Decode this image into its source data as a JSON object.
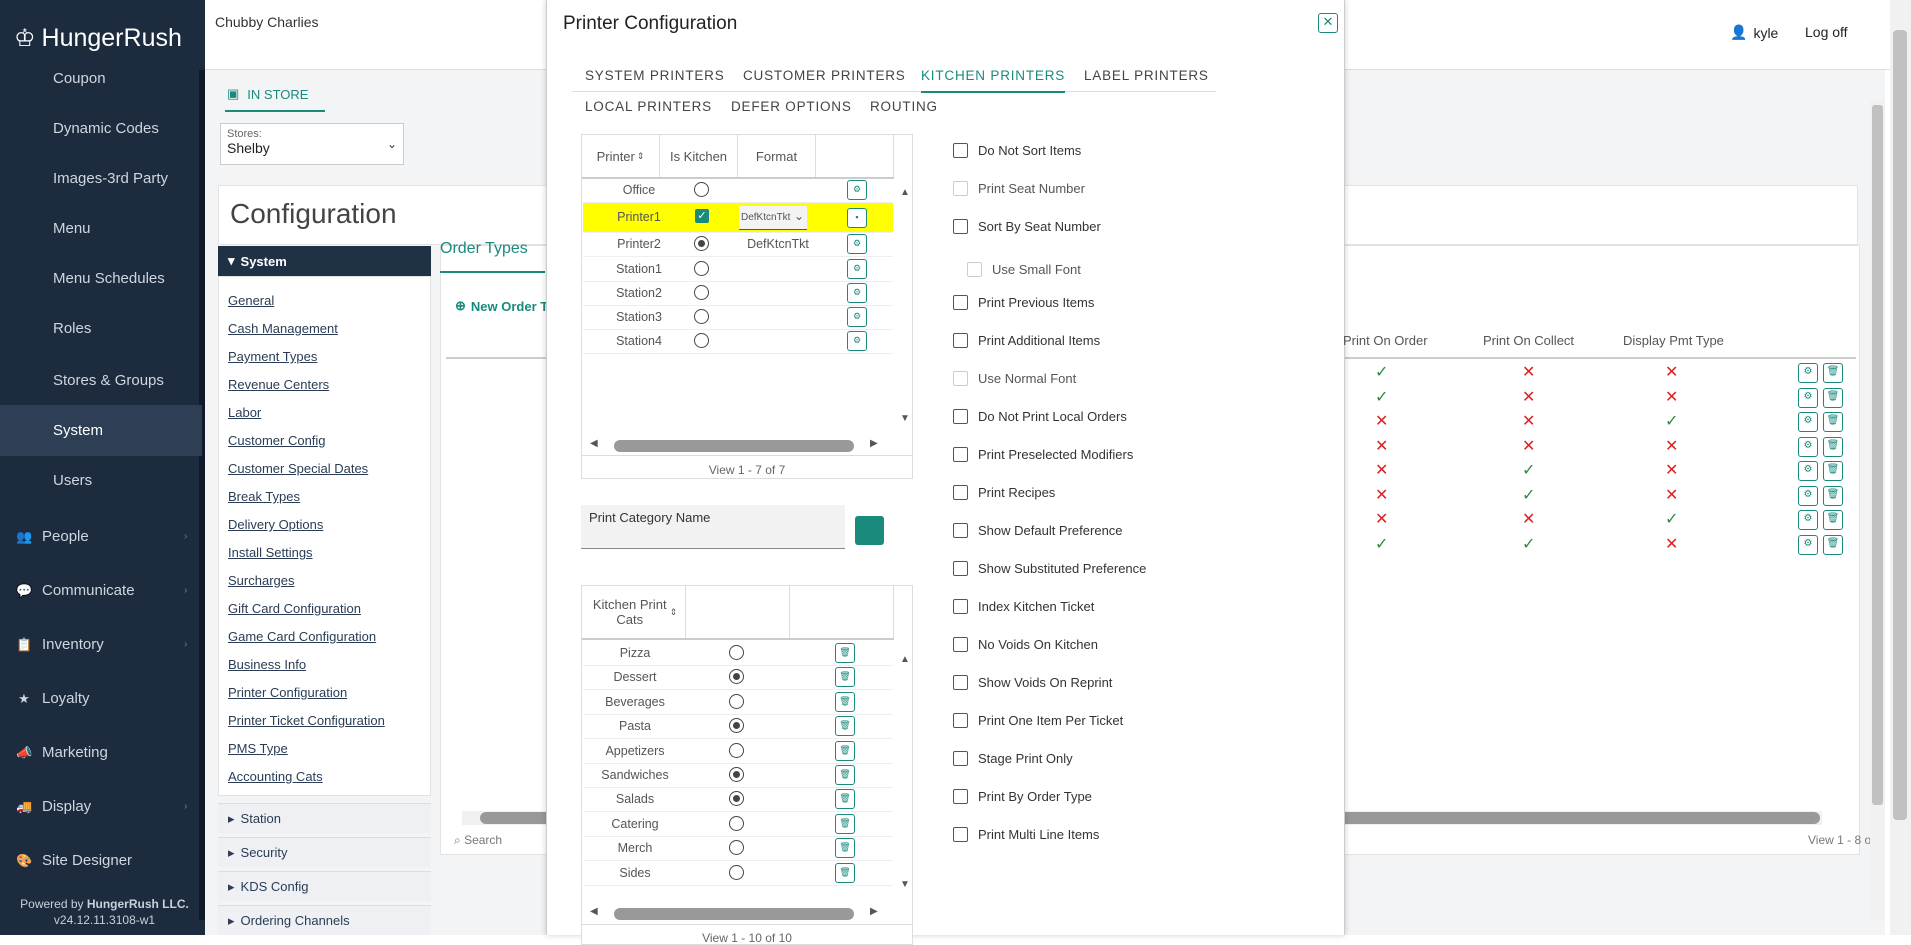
{
  "sidebar": {
    "logo": "HungerRush",
    "sub_items": [
      "Coupon",
      "Dynamic Codes",
      "Images-3rd Party",
      "Menu",
      "Menu Schedules",
      "Roles",
      "Stores & Groups",
      "System",
      "Users"
    ],
    "main_items": [
      {
        "label": "People",
        "icon": "people-icon"
      },
      {
        "label": "Communicate",
        "icon": "chat-icon"
      },
      {
        "label": "Inventory",
        "icon": "clipboard-icon"
      },
      {
        "label": "Loyalty",
        "icon": "star-icon"
      },
      {
        "label": "Marketing",
        "icon": "megaphone-icon"
      },
      {
        "label": "Display",
        "icon": "truck-icon"
      },
      {
        "label": "Site Designer",
        "icon": "palette-icon"
      }
    ],
    "powered_prefix": "Powered by ",
    "powered_brand": "HungerRush LLC.",
    "version": "v24.12.11.3108-w1"
  },
  "topbar": {
    "store_name": "Chubby Charlies",
    "user": "kyle",
    "logoff": "Log off"
  },
  "main": {
    "tab": "IN STORE",
    "stores_label": "Stores:",
    "stores_value": "Shelby",
    "title": "Configuration",
    "system_header": "System",
    "system_links": [
      "General",
      "Cash Management",
      "Payment Types",
      "Revenue Centers",
      "Labor",
      "Customer Config",
      "Customer Special Dates",
      "Break Types",
      "Delivery Options",
      "Install Settings",
      "Surcharges",
      "Gift Card Configuration",
      "Game Card Configuration",
      "Business Info",
      "Printer Configuration",
      "Printer Ticket Configuration",
      "PMS Type",
      "Accounting Cats"
    ],
    "accordions": [
      "Station",
      "Security",
      "KDS Config",
      "Ordering Channels"
    ],
    "order_types_tab": "Order Types",
    "new_order_btn": "New Order T",
    "bg_columns": [
      "Print On Order",
      "Print On Collect",
      "Display Pmt Type"
    ],
    "bg_rows": [
      [
        "check",
        "x",
        "x"
      ],
      [
        "check",
        "x",
        "x"
      ],
      [
        "x",
        "x",
        "check"
      ],
      [
        "x",
        "x",
        "x"
      ],
      [
        "x",
        "check",
        "x"
      ],
      [
        "x",
        "check",
        "x"
      ],
      [
        "x",
        "x",
        "check"
      ],
      [
        "check",
        "check",
        "x"
      ]
    ],
    "search_label": "Search",
    "view_label": "View 1 - 8 o"
  },
  "modal": {
    "title": "Printer Configuration",
    "tabs_row1": [
      "SYSTEM PRINTERS",
      "CUSTOMER PRINTERS",
      "KITCHEN PRINTERS",
      "LABEL PRINTERS"
    ],
    "tabs_row2": [
      "LOCAL PRINTERS",
      "DEFER OPTIONS",
      "ROUTING"
    ],
    "active_tab": "KITCHEN PRINTERS",
    "printers_grid": {
      "headers": [
        "Printer",
        "Is Kitchen",
        "Format",
        ""
      ],
      "rows": [
        {
          "name": "Office",
          "kitchen": "off",
          "format": ""
        },
        {
          "name": "Printer1",
          "kitchen": "checked",
          "format": "DefKtcnTkt",
          "editing": true
        },
        {
          "name": "Printer2",
          "kitchen": "on",
          "format": "DefKtcnTkt"
        },
        {
          "name": "Station1",
          "kitchen": "off",
          "format": ""
        },
        {
          "name": "Station2",
          "kitchen": "off",
          "format": ""
        },
        {
          "name": "Station3",
          "kitchen": "off",
          "format": ""
        },
        {
          "name": "Station4",
          "kitchen": "off",
          "format": ""
        }
      ],
      "footer": "View 1 - 7 of 7",
      "highlight_color": "#ffff00"
    },
    "print_category_label": "Print Category Name",
    "cats_grid": {
      "headers": [
        "Kitchen Print Cats",
        "",
        ""
      ],
      "rows": [
        {
          "name": "Pizza",
          "sel": "off"
        },
        {
          "name": "Dessert",
          "sel": "on"
        },
        {
          "name": "Beverages",
          "sel": "off"
        },
        {
          "name": "Pasta",
          "sel": "on"
        },
        {
          "name": "Appetizers",
          "sel": "off"
        },
        {
          "name": "Sandwiches",
          "sel": "on"
        },
        {
          "name": "Salads",
          "sel": "on"
        },
        {
          "name": "Catering",
          "sel": "off"
        },
        {
          "name": "Merch",
          "sel": "off"
        },
        {
          "name": "Sides",
          "sel": "off"
        }
      ],
      "footer": "View 1 - 10 of 10"
    },
    "options": [
      {
        "label": "Do Not Sort Items",
        "disabled": false,
        "indent": false
      },
      {
        "label": "Print Seat Number",
        "disabled": true,
        "indent": false
      },
      {
        "label": "Sort By Seat Number",
        "disabled": false,
        "indent": false
      },
      {
        "label": "Use Small Font",
        "disabled": true,
        "indent": true
      },
      {
        "label": "Print Previous Items",
        "disabled": false,
        "indent": false
      },
      {
        "label": "Print Additional Items",
        "disabled": false,
        "indent": false
      },
      {
        "label": "Use Normal Font",
        "disabled": true,
        "indent": false
      },
      {
        "label": "Do Not Print Local Orders",
        "disabled": false,
        "indent": false
      },
      {
        "label": "Print Preselected Modifiers",
        "disabled": false,
        "indent": false
      },
      {
        "label": "Print Recipes",
        "disabled": false,
        "indent": false
      },
      {
        "label": "Show Default Preference",
        "disabled": false,
        "indent": false
      },
      {
        "label": "Show Substituted Preference",
        "disabled": false,
        "indent": false
      },
      {
        "label": "Index Kitchen Ticket",
        "disabled": false,
        "indent": false
      },
      {
        "label": "No Voids On Kitchen",
        "disabled": false,
        "indent": false
      },
      {
        "label": "Show Voids On Reprint",
        "disabled": false,
        "indent": false
      },
      {
        "label": "Print One Item Per Ticket",
        "disabled": false,
        "indent": false
      },
      {
        "label": "Stage Print Only",
        "disabled": false,
        "indent": false
      },
      {
        "label": "Print By Order Type",
        "disabled": false,
        "indent": false
      },
      {
        "label": "Print Multi Line Items",
        "disabled": false,
        "indent": false
      }
    ]
  },
  "colors": {
    "accent": "#1a8a7d",
    "sidebar": "#1c2b3e",
    "check": "#2e8b3f",
    "cross": "#dd2222"
  }
}
